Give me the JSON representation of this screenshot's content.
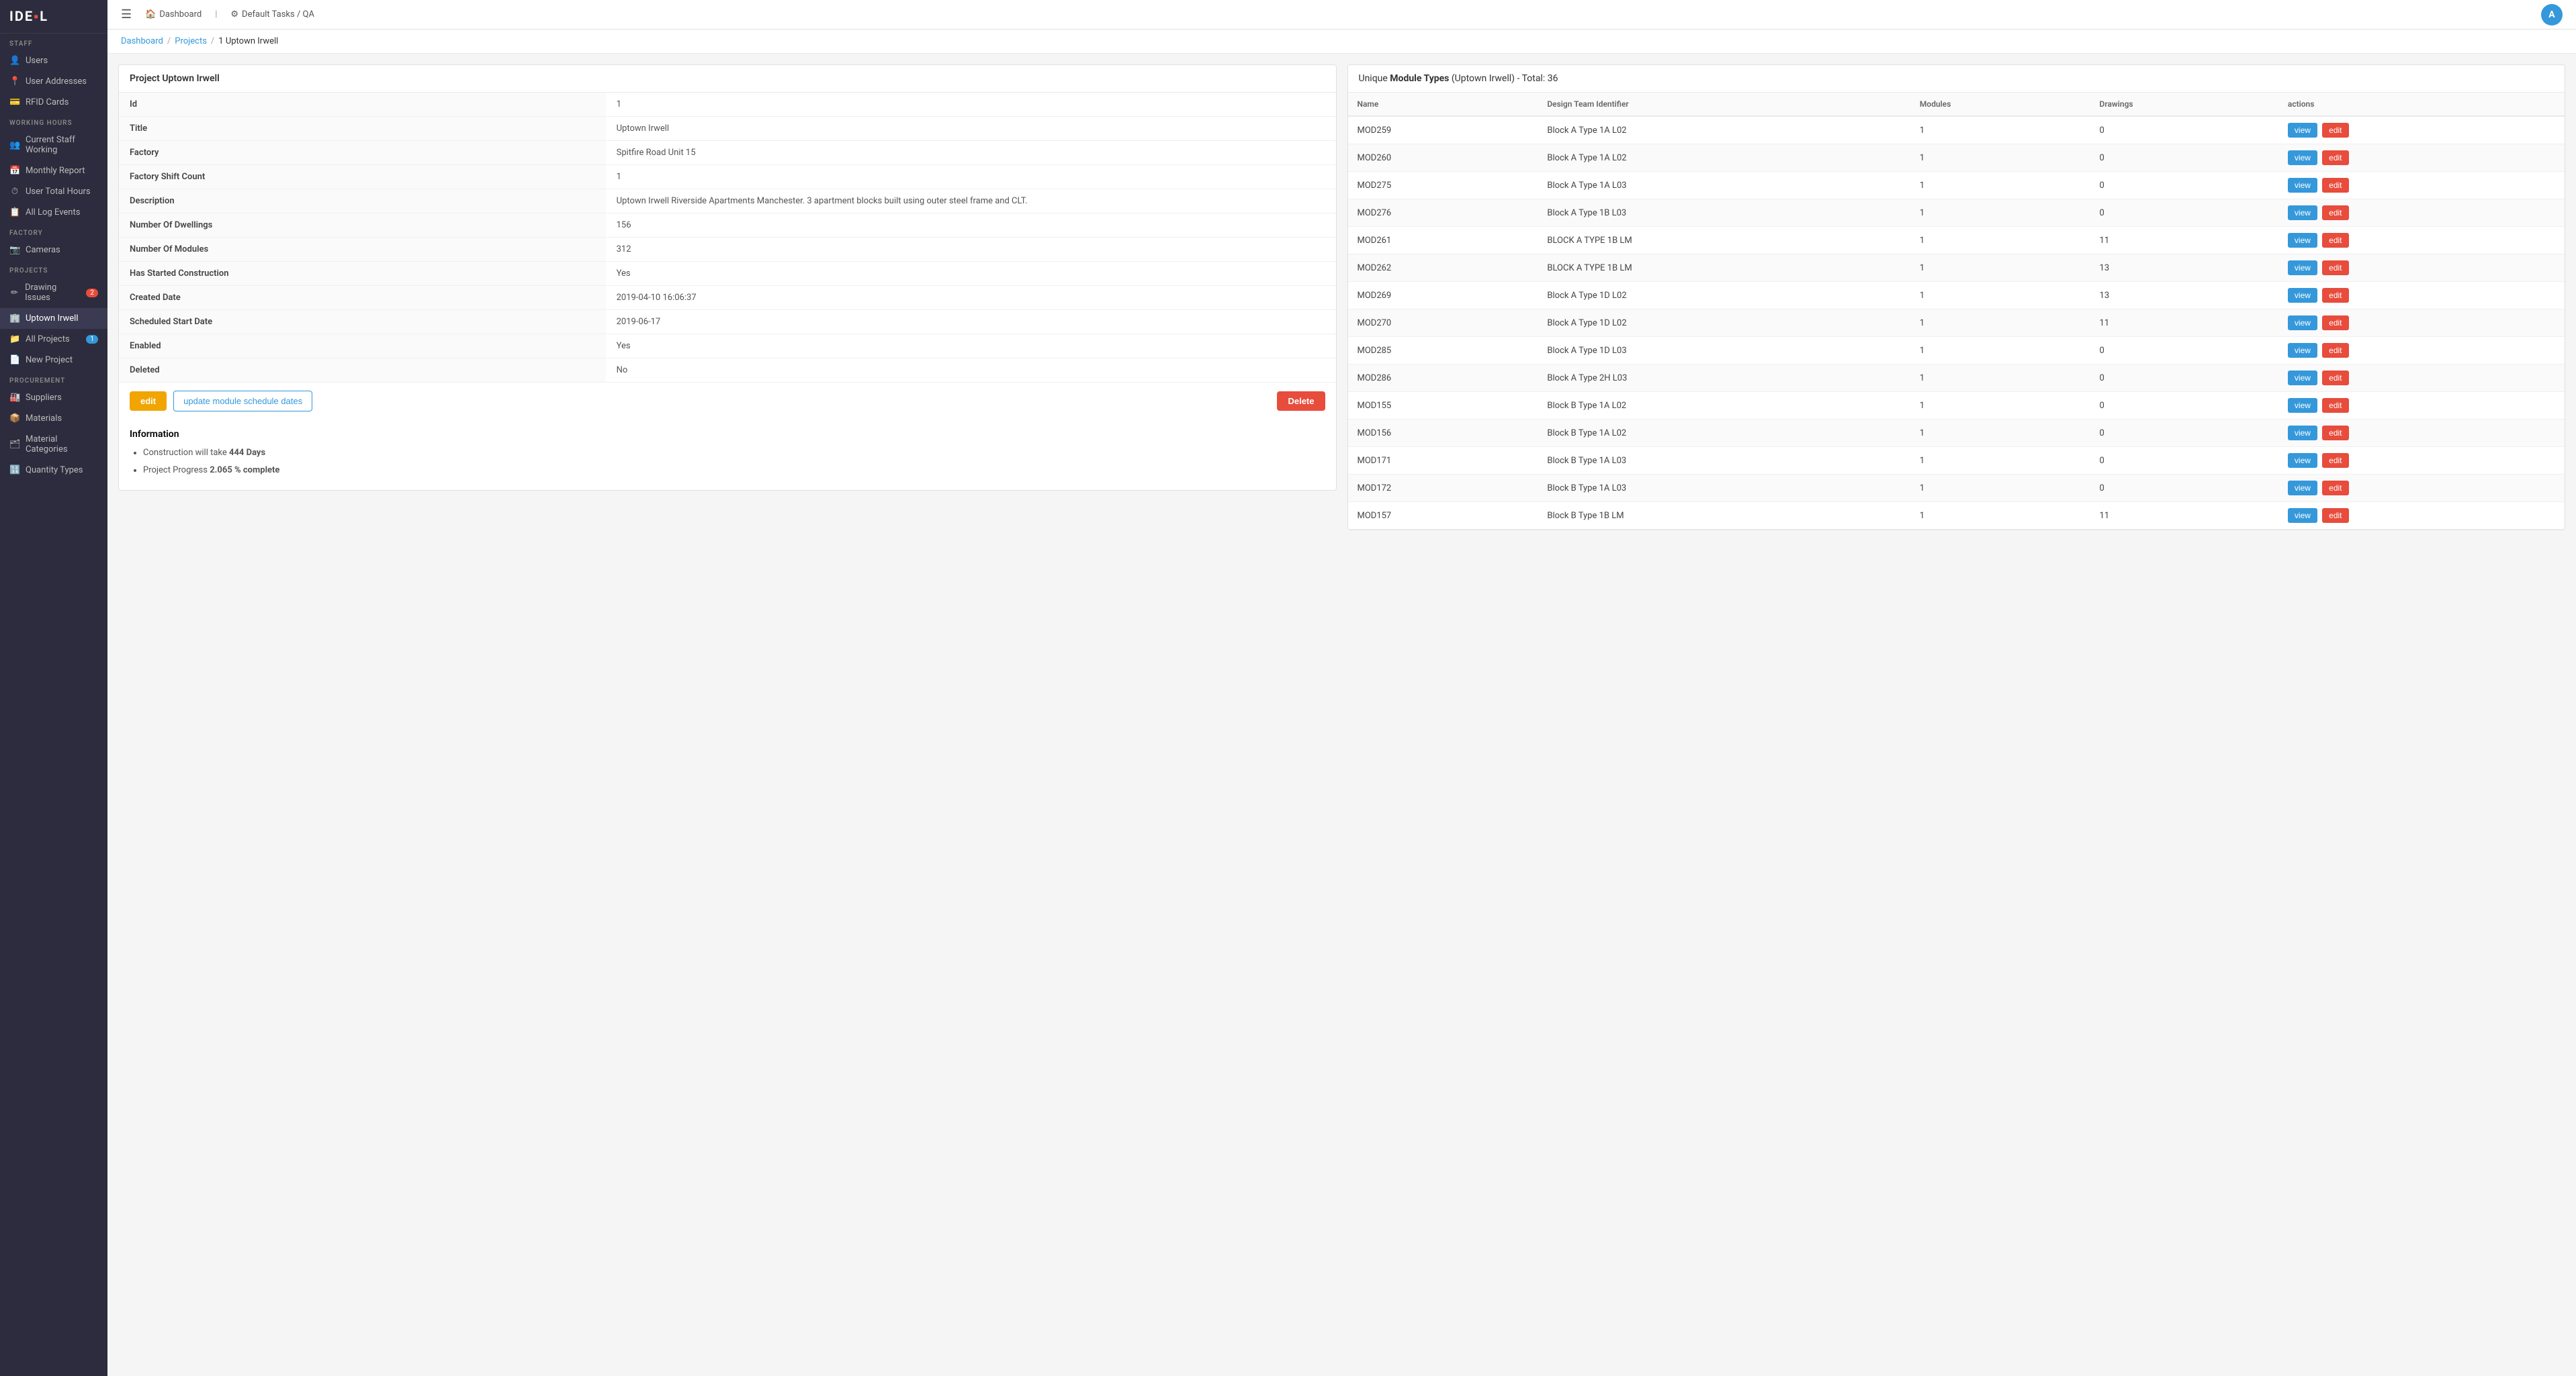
{
  "app": {
    "logo": "IDE▪L",
    "logo_accent": "▪"
  },
  "topbar": {
    "hamburger": "☰",
    "nav_links": [
      {
        "icon": "🏠",
        "label": "Dashboard"
      },
      {
        "icon": "⚙",
        "label": "Default Tasks / QA"
      }
    ],
    "avatar_initial": "A"
  },
  "breadcrumb": {
    "links": [
      "Dashboard",
      "Projects"
    ],
    "current": "1 Uptown Irwell"
  },
  "sidebar": {
    "sections": [
      {
        "label": "STAFF",
        "items": [
          {
            "id": "users",
            "icon": "👤",
            "label": "Users"
          },
          {
            "id": "user-addresses",
            "icon": "📍",
            "label": "User Addresses"
          },
          {
            "id": "rfid-cards",
            "icon": "💳",
            "label": "RFID Cards"
          }
        ]
      },
      {
        "label": "WORKING HOURS",
        "items": [
          {
            "id": "current-staff-working",
            "icon": "👥",
            "label": "Current Staff Working"
          },
          {
            "id": "monthly-report",
            "icon": "📅",
            "label": "Monthly Report"
          },
          {
            "id": "user-total-hours",
            "icon": "⏱",
            "label": "User Total Hours"
          },
          {
            "id": "all-log-events",
            "icon": "📋",
            "label": "All Log Events"
          }
        ]
      },
      {
        "label": "FACTORY",
        "items": [
          {
            "id": "cameras",
            "icon": "📷",
            "label": "Cameras"
          }
        ]
      },
      {
        "label": "PROJECTS",
        "items": [
          {
            "id": "drawing-issues",
            "icon": "✏",
            "label": "Drawing Issues",
            "badge": "2",
            "badge_type": "red"
          },
          {
            "id": "uptown-irwell",
            "icon": "🏢",
            "label": "Uptown Irwell",
            "active": true
          },
          {
            "id": "all-projects",
            "icon": "📁",
            "label": "All Projects",
            "badge": "1",
            "badge_type": "blue"
          },
          {
            "id": "new-project",
            "icon": "📄",
            "label": "New Project"
          }
        ]
      },
      {
        "label": "PROCUREMENT",
        "items": [
          {
            "id": "suppliers",
            "icon": "🏭",
            "label": "Suppliers"
          },
          {
            "id": "materials",
            "icon": "📦",
            "label": "Materials"
          },
          {
            "id": "material-categories",
            "icon": "🗂",
            "label": "Material Categories"
          },
          {
            "id": "quantity-types",
            "icon": "🔢",
            "label": "Quantity Types"
          }
        ]
      }
    ]
  },
  "project_card": {
    "title": "Project Uptown Irwell",
    "fields": [
      {
        "label": "Id",
        "value": "1"
      },
      {
        "label": "Title",
        "value": "Uptown Irwell"
      },
      {
        "label": "Factory",
        "value": "Spitfire Road Unit 15"
      },
      {
        "label": "Factory Shift Count",
        "value": "1"
      },
      {
        "label": "Description",
        "value": "Uptown Irwell Riverside Apartments Manchester. 3 apartment blocks built using outer steel frame and CLT."
      },
      {
        "label": "Number Of Dwellings",
        "value": "156"
      },
      {
        "label": "Number Of Modules",
        "value": "312"
      },
      {
        "label": "Has Started Construction",
        "value": "Yes"
      },
      {
        "label": "Created Date",
        "value": "2019-04-10 16:06:37"
      },
      {
        "label": "Scheduled Start Date",
        "value": "2019-06-17"
      },
      {
        "label": "Enabled",
        "value": "Yes"
      },
      {
        "label": "Deleted",
        "value": "No"
      }
    ],
    "btn_edit": "edit",
    "btn_update": "update module schedule dates",
    "btn_delete": "Delete"
  },
  "info_section": {
    "title": "Information",
    "items": [
      {
        "text": "Construction will take ",
        "bold": "444 Days"
      },
      {
        "text": "Project Progress ",
        "bold": "2.065 % complete"
      }
    ]
  },
  "module_types": {
    "title_prefix": "Unique ",
    "title_bold": "Module Types",
    "title_suffix": " (Uptown Irwell) - Total: 36",
    "columns": [
      "Name",
      "Design Team Identifier",
      "Modules",
      "Drawings",
      "actions"
    ],
    "rows": [
      {
        "name": "MOD259",
        "identifier": "Block A Type 1A L02",
        "modules": "1",
        "drawings": "0"
      },
      {
        "name": "MOD260",
        "identifier": "Block A Type 1A L02",
        "modules": "1",
        "drawings": "0"
      },
      {
        "name": "MOD275",
        "identifier": "Block A Type 1A L03",
        "modules": "1",
        "drawings": "0"
      },
      {
        "name": "MOD276",
        "identifier": "Block A Type 1B L03",
        "modules": "1",
        "drawings": "0"
      },
      {
        "name": "MOD261",
        "identifier": "BLOCK A TYPE 1B LM",
        "modules": "1",
        "drawings": "11"
      },
      {
        "name": "MOD262",
        "identifier": "BLOCK A TYPE 1B LM",
        "modules": "1",
        "drawings": "13"
      },
      {
        "name": "MOD269",
        "identifier": "Block A Type 1D L02",
        "modules": "1",
        "drawings": "13"
      },
      {
        "name": "MOD270",
        "identifier": "Block A Type 1D L02",
        "modules": "1",
        "drawings": "11"
      },
      {
        "name": "MOD285",
        "identifier": "Block A Type 1D L03",
        "modules": "1",
        "drawings": "0"
      },
      {
        "name": "MOD286",
        "identifier": "Block A Type 2H L03",
        "modules": "1",
        "drawings": "0"
      },
      {
        "name": "MOD155",
        "identifier": "Block B Type 1A L02",
        "modules": "1",
        "drawings": "0"
      },
      {
        "name": "MOD156",
        "identifier": "Block B Type 1A L02",
        "modules": "1",
        "drawings": "0"
      },
      {
        "name": "MOD171",
        "identifier": "Block B Type 1A L03",
        "modules": "1",
        "drawings": "0"
      },
      {
        "name": "MOD172",
        "identifier": "Block B Type 1A L03",
        "modules": "1",
        "drawings": "0"
      },
      {
        "name": "MOD157",
        "identifier": "Block B Type 1B LM",
        "modules": "1",
        "drawings": "11"
      }
    ],
    "btn_view": "view",
    "btn_edit": "edit"
  }
}
